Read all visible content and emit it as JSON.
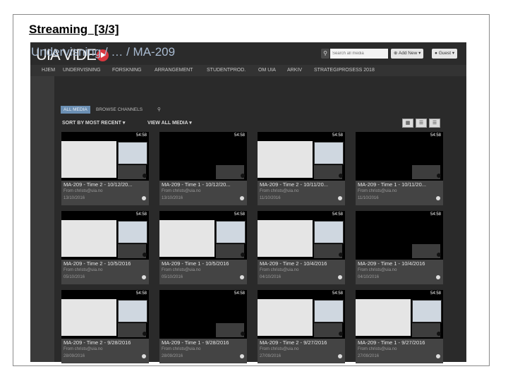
{
  "slide": {
    "title": "Streaming  [3/3]"
  },
  "header": {
    "logo_text": "UIA VIDE",
    "search_placeholder": "Search all media",
    "add_new_label": "Add New",
    "guest_label": "Guest"
  },
  "nav": {
    "items": [
      "HJEM",
      "UNDERVISNING",
      "FORSKNING",
      "ARRANGEMENT",
      "STUDENTPROD.",
      "OM UIA",
      "ARKIV",
      "STRATEGIPROSESS 2018"
    ]
  },
  "page": {
    "title": "Undervisning / … / MA-209",
    "tabs": [
      "ALL MEDIA",
      "BROWSE CHANNELS"
    ],
    "sort_label": "SORT BY MOST RECENT",
    "view_label": "VIEW ALL MEDIA"
  },
  "videos": [
    {
      "title": "MA-209 - Time 2 - 10/12/20...",
      "from": "From christs@uia.no",
      "date": "13/10/2016",
      "duration": "54:58"
    },
    {
      "title": "MA-209 - Time 1 - 10/12/20...",
      "from": "From christs@uia.no",
      "date": "13/10/2016",
      "duration": "54:58"
    },
    {
      "title": "MA-209 - Time 2 - 10/11/20...",
      "from": "From christs@uia.no",
      "date": "11/10/2016",
      "duration": "54:58"
    },
    {
      "title": "MA-209 - Time 1 - 10/11/20...",
      "from": "From christs@uia.no",
      "date": "11/10/2016",
      "duration": "54:58"
    },
    {
      "title": "MA-209 - Time 2 - 10/5/2016",
      "from": "From christs@uia.no",
      "date": "05/10/2016",
      "duration": "54:58"
    },
    {
      "title": "MA-209 - Time 1 - 10/5/2016",
      "from": "From christs@uia.no",
      "date": "05/10/2016",
      "duration": "54:58"
    },
    {
      "title": "MA-209 - Time 2 - 10/4/2016",
      "from": "From christs@uia.no",
      "date": "04/10/2016",
      "duration": "54:58"
    },
    {
      "title": "MA-209 - Time 1 - 10/4/2016",
      "from": "From christs@uia.no",
      "date": "04/10/2016",
      "duration": "54:58"
    },
    {
      "title": "MA-209 - Time 2 - 9/28/2016",
      "from": "From christs@uia.no",
      "date": "28/09/2016",
      "duration": "54:58"
    },
    {
      "title": "MA-209 - Time 1 - 9/28/2016",
      "from": "From christs@uia.no",
      "date": "28/09/2016",
      "duration": "54:58"
    },
    {
      "title": "MA-209 - Time 2 - 9/27/2016",
      "from": "From christs@uia.no",
      "date": "27/09/2016",
      "duration": "54:58"
    },
    {
      "title": "MA-209 - Time 1 - 9/27/2016",
      "from": "From christs@uia.no",
      "date": "27/09/2016",
      "duration": "54:58"
    }
  ],
  "colors": {
    "brand_red": "#d9363e",
    "title_blue": "#a9bbd1",
    "tab_active": "#6b8fb3"
  }
}
